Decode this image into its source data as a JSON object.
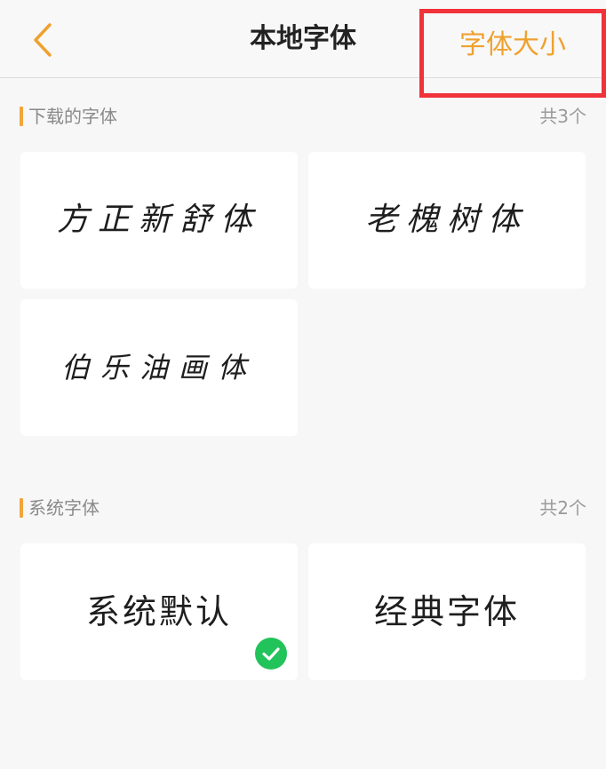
{
  "header": {
    "title": "本地字体",
    "font_size_label": "字体大小",
    "back_icon": "chevron-left-icon",
    "accent_color": "#efa12e",
    "highlight_color": "#f0323a"
  },
  "downloaded": {
    "title": "下载的字体",
    "count": "共3个",
    "fonts": [
      {
        "label": "方正新舒体"
      },
      {
        "label": "老槐树体"
      },
      {
        "label": "伯乐油画体"
      }
    ]
  },
  "system": {
    "title": "系统字体",
    "count": "共2个",
    "fonts": [
      {
        "label": "系统默认",
        "selected": true
      },
      {
        "label": "经典字体",
        "selected": false
      }
    ],
    "check_icon": "check-circle-icon",
    "check_color": "#22c35a"
  }
}
